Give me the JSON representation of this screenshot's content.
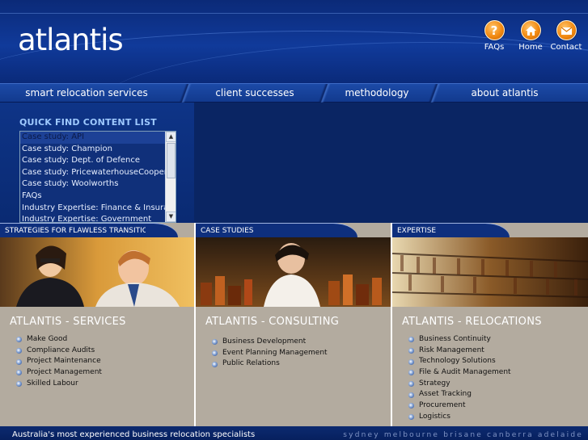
{
  "header": {
    "logo": "atlantis",
    "links": [
      {
        "label": "FAQs",
        "icon": "question-icon"
      },
      {
        "label": "Home",
        "icon": "house-icon"
      },
      {
        "label": "Contact",
        "icon": "envelope-icon"
      }
    ]
  },
  "nav": {
    "items": [
      {
        "label": "smart relocation services"
      },
      {
        "label": "client successes"
      },
      {
        "label": "methodology"
      },
      {
        "label": "about atlantis"
      }
    ]
  },
  "quick_find": {
    "title": "QUICK FIND CONTENT LIST",
    "items": [
      "Case study: API",
      "Case study: Champion",
      "Case study: Dept. of Defence",
      "Case study: PricewaterhouseCoopers",
      "Case study: Woolworths",
      "FAQs",
      "Industry Expertise: Finance & Insurance",
      "Industry Expertise: Government"
    ]
  },
  "columns": [
    {
      "tab": "STRATEGIES FOR FLAWLESS TRANSITION",
      "title": "ATLANTIS - SERVICES",
      "items": [
        "Make Good",
        "Compliance Audits",
        "Project Maintenance",
        "Project Management",
        "Skilled Labour"
      ]
    },
    {
      "tab": "CASE STUDIES",
      "title": "ATLANTIS - CONSULTING",
      "items": [
        "Business Development",
        "Event Planning Management",
        "Public Relations"
      ]
    },
    {
      "tab": "EXPERTISE",
      "title": "ATLANTIS - RELOCATIONS",
      "items": [
        "Business Continuity",
        "Risk Management",
        "Technology Solutions",
        "File & Audit Management",
        "Strategy",
        "Asset Tracking",
        "Procurement",
        "Logistics"
      ]
    }
  ],
  "footer": {
    "tagline": "Australia's most experienced business relocation specialists",
    "cities": "sydney melbourne brisane canberra adelaide"
  },
  "colors": {
    "accent_orange": "#f28a12",
    "navy": "#0a2563",
    "content_bg": "#b3ab9f"
  }
}
